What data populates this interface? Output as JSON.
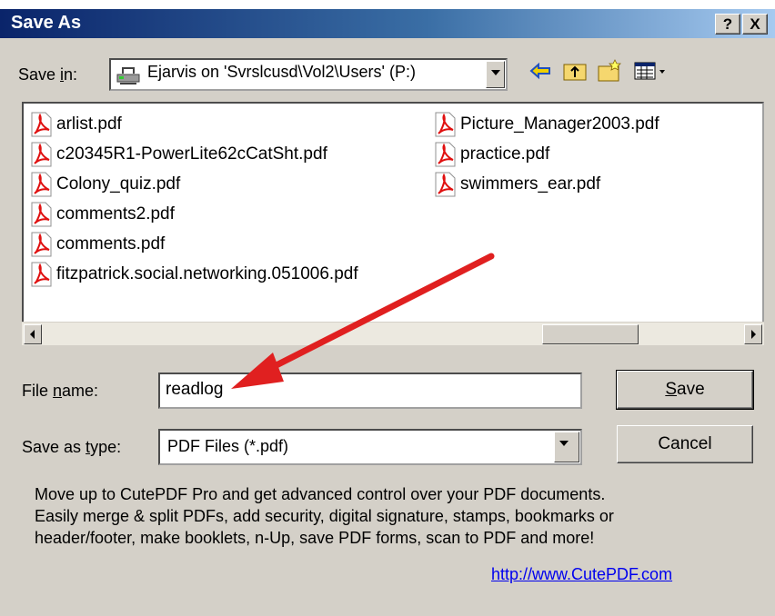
{
  "window": {
    "title": "Save As",
    "help_label": "?",
    "close_label": "X"
  },
  "save_in": {
    "label_prefix": "Save ",
    "label_accel": "i",
    "label_suffix": "n:",
    "value": "Ejarvis on 'Svrslcusd\\Vol2\\Users' (P:)"
  },
  "toolbar": {
    "icons": [
      "back-arrow-icon",
      "up-folder-icon",
      "new-folder-icon",
      "view-menu-icon"
    ]
  },
  "files": {
    "col1": [
      "arlist.pdf",
      "c20345R1-PowerLite62cCatSht.pdf",
      "Colony_quiz.pdf",
      "comments2.pdf",
      "comments.pdf",
      "fitzpatrick.social.networking.051006.pdf"
    ],
    "col2": [
      "Picture_Manager2003.pdf",
      "practice.pdf",
      "swimmers_ear.pdf"
    ]
  },
  "file_name": {
    "label_prefix": "File ",
    "label_accel": "n",
    "label_suffix": "ame:",
    "value": "readlog"
  },
  "save_type": {
    "label_prefix": "Save as ",
    "label_accel": "t",
    "label_suffix": "ype:",
    "value": "PDF Files (*.pdf)"
  },
  "buttons": {
    "save_accel": "S",
    "save_rest": "ave",
    "cancel": "Cancel"
  },
  "promo": {
    "lines": [
      "Move up to CutePDF Pro and get advanced control over your PDF documents.",
      "Easily merge & split PDFs, add security, digital signature, stamps, bookmarks or",
      "header/footer, make booklets, n-Up, save PDF forms, scan to PDF and more!"
    ],
    "link": "http://www.CutePDF.com"
  },
  "colors": {
    "titlebar_start": "#0a246a",
    "titlebar_end": "#a6caf0",
    "dialog_bg": "#d4d0c8",
    "annotation_arrow": "#e02020",
    "link": "#0000ee"
  }
}
